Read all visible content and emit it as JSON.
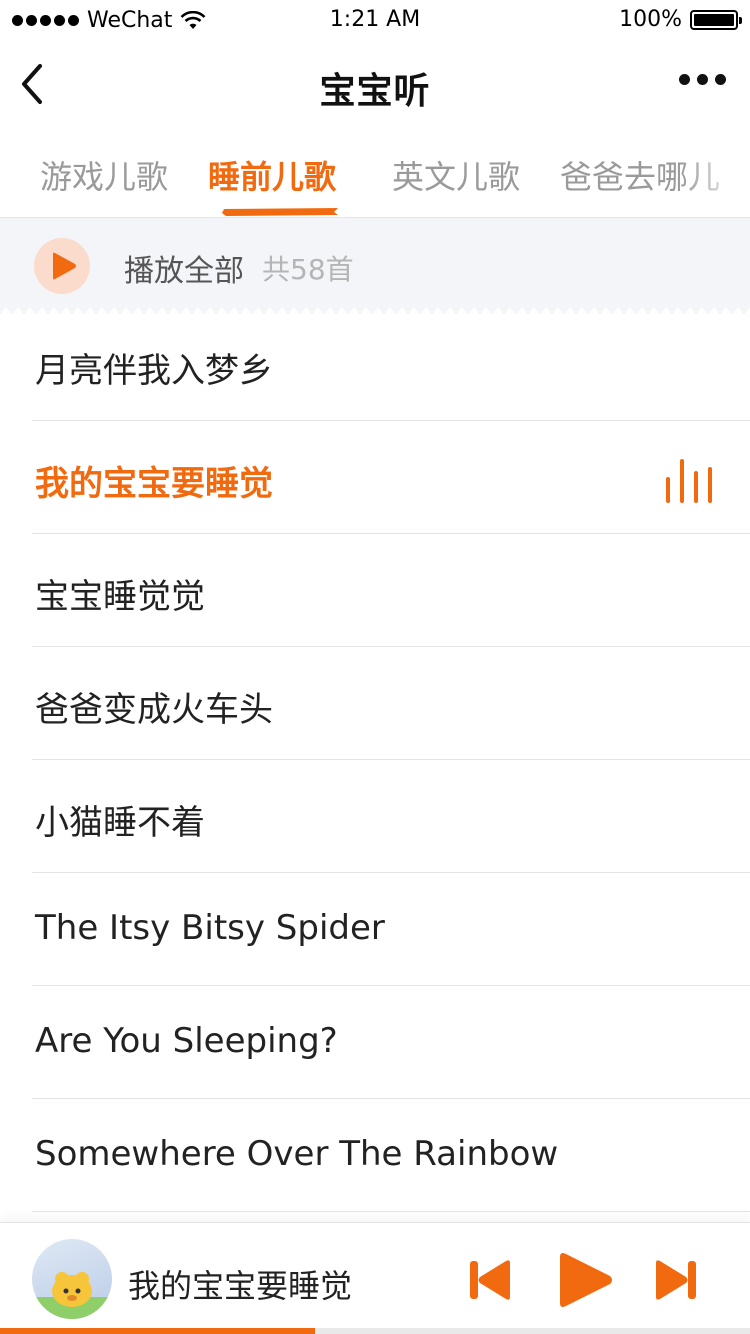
{
  "status_bar": {
    "carrier": "WeChat",
    "time": "1:21 AM",
    "battery": "100%"
  },
  "nav": {
    "title": "宝宝听"
  },
  "tabs": [
    {
      "label": "游戏儿歌",
      "active": false
    },
    {
      "label": "睡前儿歌",
      "active": true
    },
    {
      "label": "英文儿歌",
      "active": false
    },
    {
      "label": "爸爸去哪儿",
      "active": false
    }
  ],
  "play_all": {
    "label": "播放全部",
    "count": "共58首"
  },
  "songs": [
    {
      "title": "月亮伴我入梦乡",
      "playing": false
    },
    {
      "title": "我的宝宝要睡觉",
      "playing": true
    },
    {
      "title": "宝宝睡觉觉",
      "playing": false
    },
    {
      "title": "爸爸变成火车头",
      "playing": false
    },
    {
      "title": "小猫睡不着",
      "playing": false
    },
    {
      "title": "The Itsy Bitsy Spider",
      "playing": false
    },
    {
      "title": "Are You Sleeping?",
      "playing": false
    },
    {
      "title": "Somewhere Over The Rainbow",
      "playing": false
    }
  ],
  "player": {
    "title": "我的宝宝要睡觉",
    "progress": 0.42
  },
  "colors": {
    "accent": "#f26a0f",
    "play_all_bg": "#f3f5f8"
  },
  "icons": {
    "back": "chevron-left-icon",
    "more": "more-dots-icon",
    "play_all": "play-icon",
    "playing_indicator": "equalizer-icon",
    "prev": "skip-previous-icon",
    "play": "play-icon",
    "next": "skip-next-icon"
  }
}
